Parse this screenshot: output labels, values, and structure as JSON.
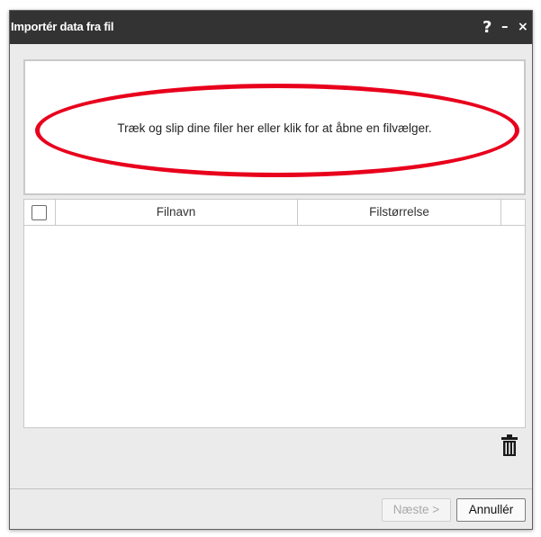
{
  "dialog": {
    "title": "Importér data fra fil",
    "help_label": "?",
    "minimize_label": "–",
    "close_label": "×"
  },
  "drop_zone": {
    "text": "Træk og slip dine filer her eller klik for at åbne en filvælger."
  },
  "file_table": {
    "columns": [
      "Filnavn",
      "Filstørrelse"
    ],
    "rows": []
  },
  "footer": {
    "next_label": "Næste >",
    "cancel_label": "Annullér"
  },
  "colors": {
    "titlebar": "#333333",
    "highlight": "#e8001c",
    "dialog_bg": "#ebebeb"
  },
  "icons": {
    "delete": "trash-icon"
  }
}
